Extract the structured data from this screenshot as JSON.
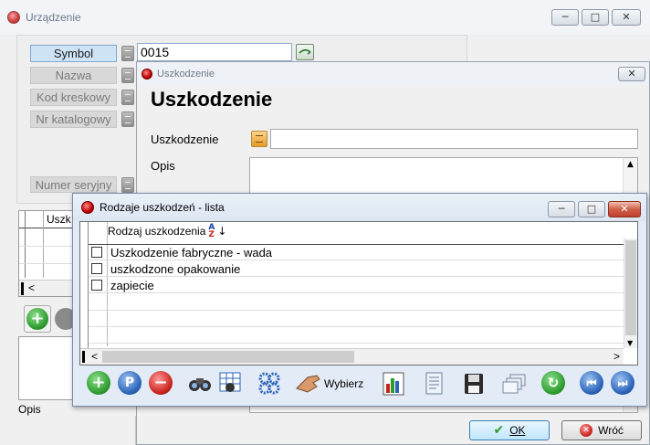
{
  "urzadzenie": {
    "title": "Urządzenie",
    "fields": [
      {
        "label": "Symbol",
        "value": "0015"
      },
      {
        "label": "Nazwa"
      },
      {
        "label": "Kod kreskowy"
      },
      {
        "label": "Nr katalogowy"
      },
      {
        "label": "Numer seryjny"
      }
    ],
    "grid_header_cut": "Uszk",
    "scroll_left": "<",
    "opis_label": "Opis"
  },
  "uszkodzenie": {
    "title": "Uszkodzenie",
    "heading": "Uszkodzenie",
    "field_label": "Uszkodzenie",
    "opis_label": "Opis",
    "ok_label": "OK",
    "cancel_label": "Wróć",
    "ok_underline": "O",
    "cancel_underline": "W"
  },
  "lista": {
    "title": "Rodzaje uszkodzeń - lista",
    "column_header": "Rodzaj uszkodzenia",
    "rows": [
      {
        "text": "Uszkodzenie fabryczne - wada"
      },
      {
        "text": "uszkodzone opakowanie"
      },
      {
        "text": "zapiecie"
      }
    ],
    "select_label": "Wybierz",
    "scroll_left": "<",
    "scroll_right": ">"
  },
  "colors": {
    "accent_blue": "#2a63b8",
    "add_green": "#2e9b2e",
    "remove_red": "#c8231b"
  }
}
